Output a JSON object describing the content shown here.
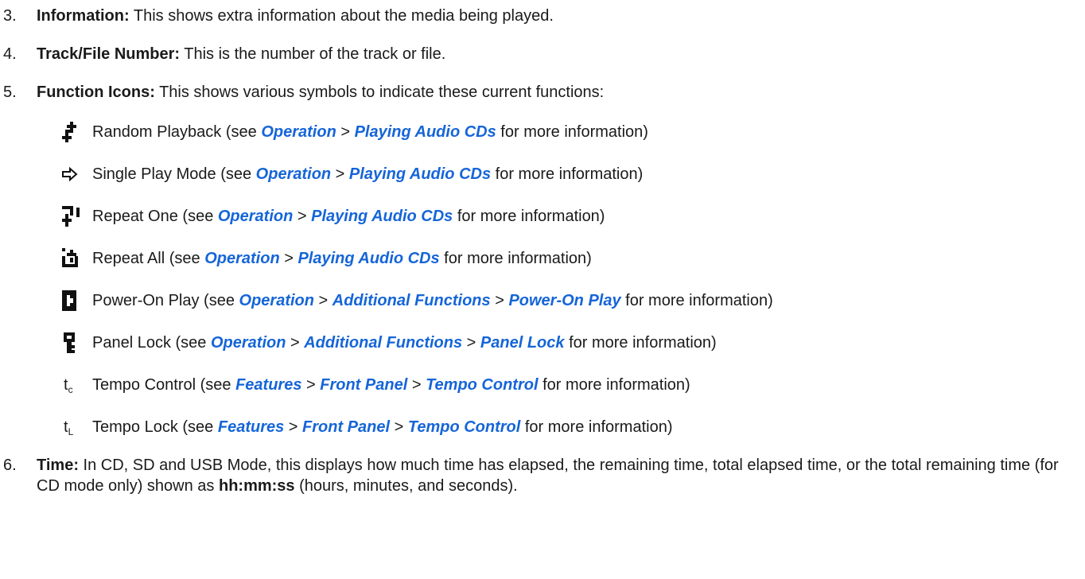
{
  "items": [
    {
      "num": "3.",
      "term": "Information:",
      "desc": " This shows extra information about the media being played."
    },
    {
      "num": "4.",
      "term": "Track/File Number:",
      "desc": " This is the number of the track or file."
    },
    {
      "num": "5.",
      "term": "Function Icons:",
      "desc": " This shows various symbols to indicate these current functions:"
    },
    {
      "num": "6.",
      "term": "Time:",
      "desc": " In CD, SD and USB Mode, this displays how much time has elapsed, the remaining time, total elapsed time, or the total remaining time (for CD mode only) shown as ",
      "fmt": "hh:mm:ss",
      "tail": " (hours, minutes, and seconds)."
    }
  ],
  "functions": [
    {
      "icon": "random-playback-icon",
      "label": "Random Playback (see ",
      "links": [
        "Operation",
        "Playing Audio CDs"
      ],
      "suffix": " for more information)"
    },
    {
      "icon": "single-play-icon",
      "label": "Single Play Mode (see ",
      "links": [
        "Operation",
        "Playing Audio CDs"
      ],
      "suffix": " for more information)"
    },
    {
      "icon": "repeat-one-icon",
      "label": "Repeat One (see ",
      "links": [
        "Operation",
        "Playing Audio CDs"
      ],
      "suffix": " for more information)"
    },
    {
      "icon": "repeat-all-icon",
      "label": "Repeat All (see ",
      "links": [
        "Operation",
        "Playing Audio CDs"
      ],
      "suffix": " for more information)"
    },
    {
      "icon": "power-on-play-icon",
      "label": "Power-On Play (see ",
      "links": [
        "Operation",
        "Additional Functions",
        "Power-On Play"
      ],
      "suffix": " for more information)"
    },
    {
      "icon": "panel-lock-icon",
      "label": "Panel Lock (see ",
      "links": [
        "Operation",
        "Additional Functions",
        "Panel Lock"
      ],
      "suffix": " for more information)"
    },
    {
      "icon": "tempo-control-icon",
      "glyph": "t",
      "sub": "c",
      "label": "Tempo Control (see ",
      "links": [
        "Features",
        "Front Panel",
        "Tempo Control"
      ],
      "suffix": " for more information)"
    },
    {
      "icon": "tempo-lock-icon",
      "glyph": "t",
      "sub": "L",
      "label": "Tempo Lock (see ",
      "links": [
        "Features",
        "Front Panel",
        "Tempo Control"
      ],
      "suffix": " for more information)"
    }
  ],
  "separator": " > ",
  "colors": {
    "link": "#1565d8",
    "text": "#1a1a1a"
  }
}
